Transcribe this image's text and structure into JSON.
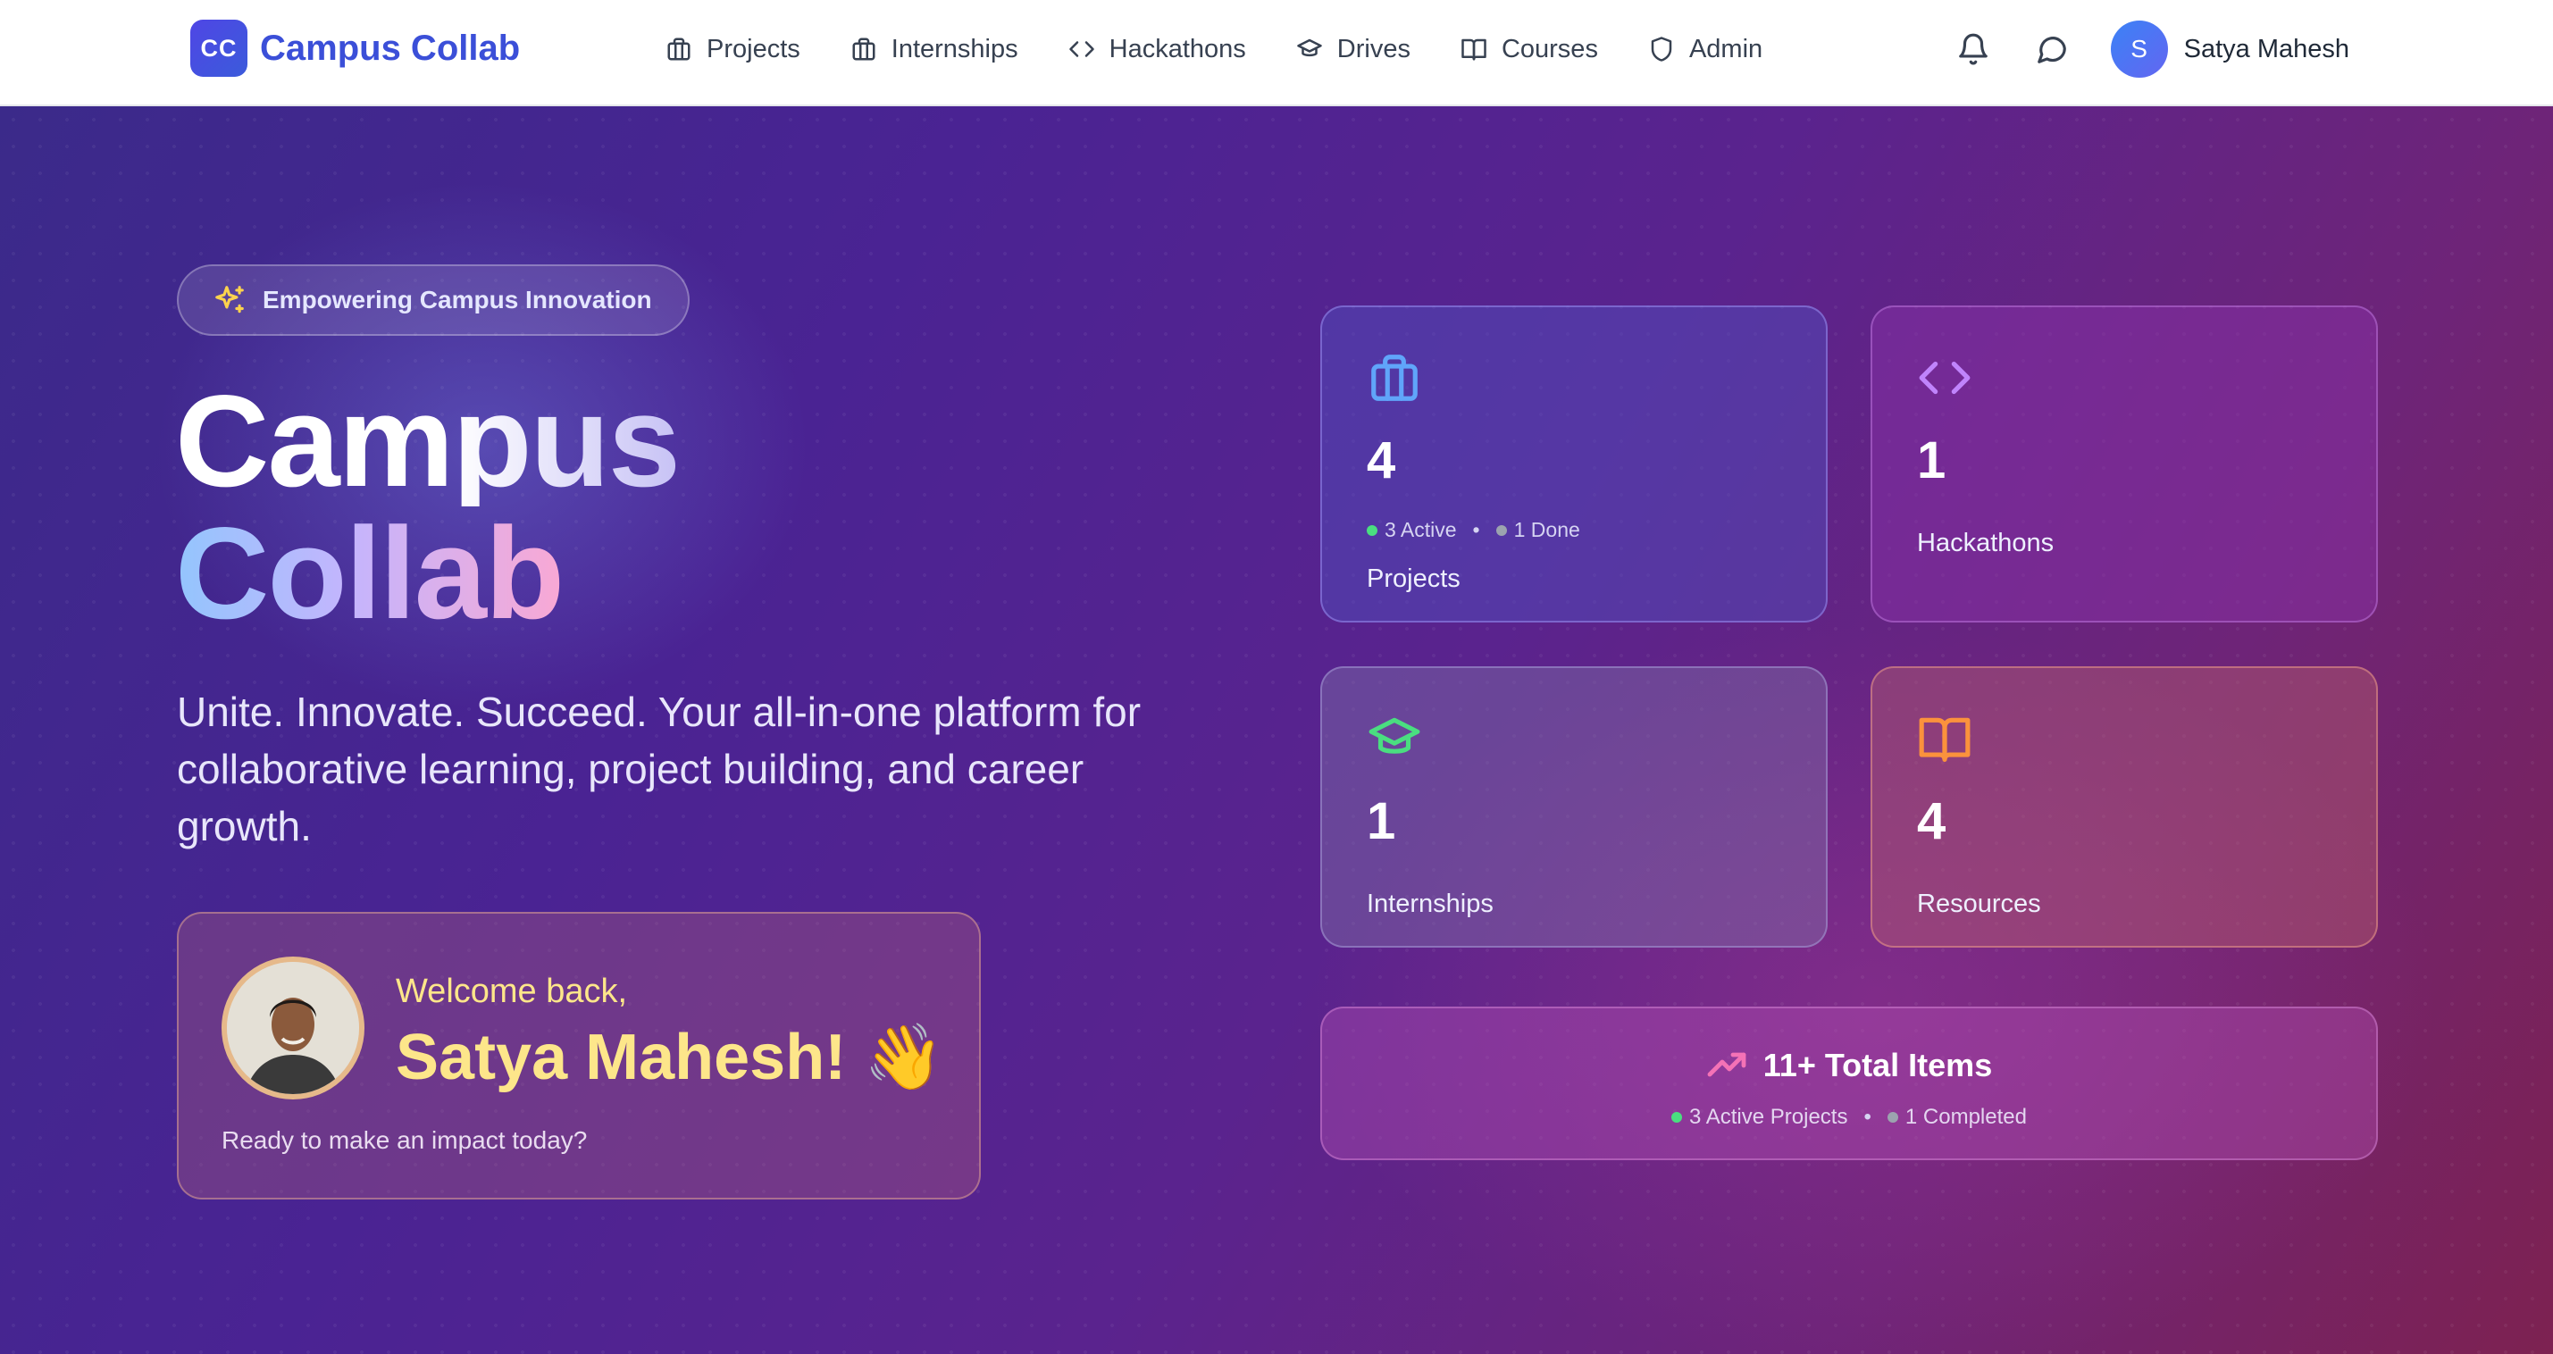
{
  "nav": {
    "logo_mark": "CC",
    "brand": "Campus Collab",
    "links": [
      {
        "label": "Projects",
        "icon": "briefcase-icon"
      },
      {
        "label": "Internships",
        "icon": "briefcase-icon"
      },
      {
        "label": "Hackathons",
        "icon": "code-icon"
      },
      {
        "label": "Drives",
        "icon": "graduation-cap-icon"
      },
      {
        "label": "Courses",
        "icon": "book-open-icon"
      },
      {
        "label": "Admin",
        "icon": "shield-icon"
      }
    ],
    "user": {
      "initial": "S",
      "name": "Satya Mahesh"
    }
  },
  "hero": {
    "badge": "Empowering Campus Innovation",
    "title_line1": "Campus",
    "title_line2": "Collab",
    "tagline": "Unite. Innovate. Succeed. Your all-in-one platform for collaborative learning, project building, and career growth.",
    "welcome": {
      "greeting": "Welcome back,",
      "name": "Satya Mahesh! 👋",
      "subtitle": "Ready to make an impact today?"
    }
  },
  "stats": {
    "projects": {
      "count": "4",
      "active": "3 Active",
      "done": "1 Done",
      "label": "Projects"
    },
    "hackathons": {
      "count": "1",
      "label": "Hackathons"
    },
    "internships": {
      "count": "1",
      "label": "Internships"
    },
    "resources": {
      "count": "4",
      "label": "Resources"
    },
    "total": {
      "title": "11+ Total Items",
      "active": "3 Active Projects",
      "completed": "1 Completed"
    }
  },
  "colors": {
    "brand": "#3b4fd8",
    "active_dot": "#4ade80",
    "done_dot": "#9ca3af",
    "welcome_text": "#fde68a"
  }
}
